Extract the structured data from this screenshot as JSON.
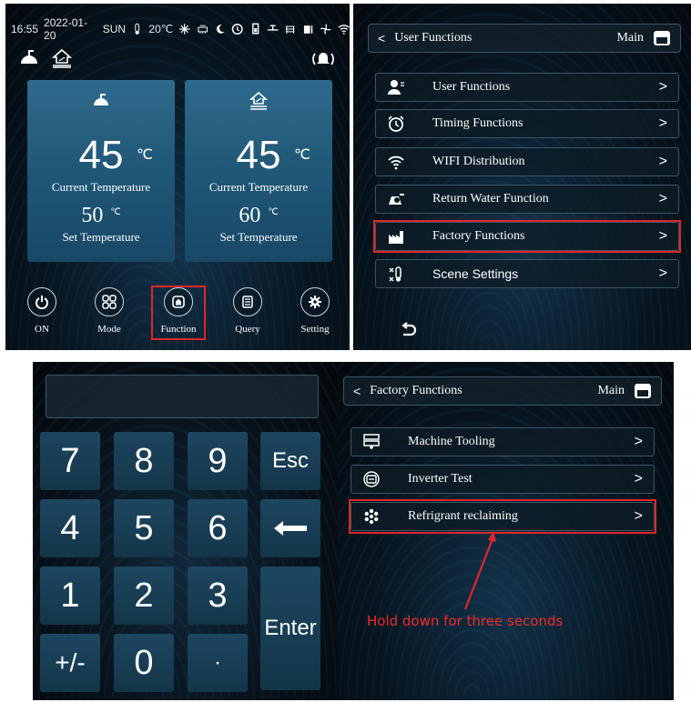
{
  "home_screen": {
    "status_bar": {
      "time": "16:55",
      "date": "2022-01-20",
      "weekday": "SUN",
      "outdoor_temp": "20℃"
    },
    "cards": [
      {
        "icon": "shower-icon",
        "value": "45",
        "unit": "℃",
        "current_label": "Current Temperature",
        "set_value": "50",
        "set_unit": "℃",
        "set_label": "Set Temperature"
      },
      {
        "icon": "floor-heating-icon",
        "value": "45",
        "unit": "℃",
        "current_label": "Current Temperature",
        "set_value": "60",
        "set_unit": "℃",
        "set_label": "Set Temperature"
      }
    ],
    "buttons": [
      {
        "icon": "power-icon",
        "label": "ON"
      },
      {
        "icon": "grid-icon",
        "label": "Mode"
      },
      {
        "icon": "function-icon",
        "label": "Function"
      },
      {
        "icon": "query-icon",
        "label": "Query"
      },
      {
        "icon": "gear-icon",
        "label": "Setting"
      }
    ]
  },
  "user_functions_screen": {
    "header": {
      "back": "<",
      "title": "User Functions",
      "main": "Main"
    },
    "items": [
      {
        "icon": "user-icon",
        "label": "User Functions",
        "chevron": ">"
      },
      {
        "icon": "alarm-clock-icon",
        "label": "Timing Functions",
        "chevron": ">"
      },
      {
        "icon": "wifi-icon",
        "label": "WIFI Distribution",
        "chevron": ">"
      },
      {
        "icon": "water-pump-icon",
        "label": "Return Water Function",
        "chevron": ">"
      },
      {
        "icon": "factory-icon",
        "label": "Factory Functions",
        "chevron": ">"
      },
      {
        "icon": "scene-icon",
        "label": "Scene Settings",
        "chevron": ">"
      }
    ]
  },
  "keypad_screen": {
    "display_value": "",
    "keys": [
      "7",
      "8",
      "9",
      "Esc",
      "4",
      "5",
      "6",
      "←",
      "1",
      "2",
      "3",
      "Enter",
      "+/-",
      "0",
      "·"
    ]
  },
  "factory_functions_screen": {
    "header": {
      "back": "<",
      "title": "Factory Functions",
      "main": "Main"
    },
    "items": [
      {
        "icon": "machine-icon",
        "label": "Machine Tooling",
        "chevron": ">"
      },
      {
        "icon": "inverter-icon",
        "label": "Inverter Test",
        "chevron": ">"
      },
      {
        "icon": "snowflake-icon",
        "label": "Refrigrant reclaiming",
        "chevron": ">"
      }
    ],
    "annotation": "Hold down for three seconds",
    "highlight_color": "#e0262a"
  }
}
